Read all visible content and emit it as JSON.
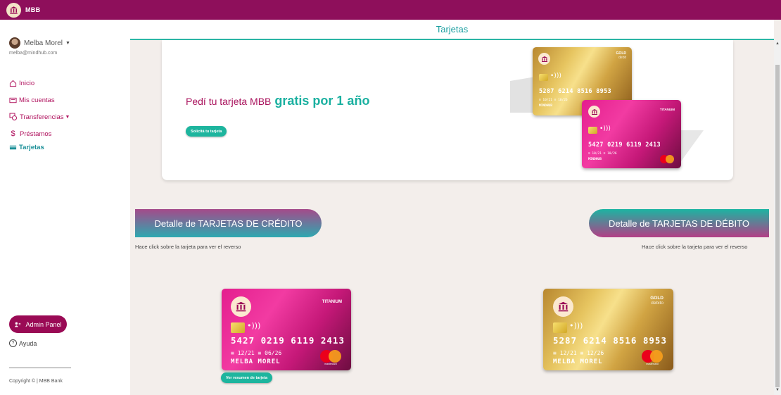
{
  "app": {
    "brand": "MBB",
    "page_title": "Tarjetas"
  },
  "user": {
    "name": "Melba Morel",
    "email": "melba@mindhub.com"
  },
  "nav": {
    "items": [
      {
        "label": "Inicio",
        "icon": "home-icon"
      },
      {
        "label": "Mis cuentas",
        "icon": "wallet-icon"
      },
      {
        "label": "Transferencias",
        "icon": "transfer-icon"
      },
      {
        "label": "Préstamos",
        "icon": "dollar-icon"
      },
      {
        "label": "Tarjetas",
        "icon": "card-icon",
        "active": true
      }
    ]
  },
  "sidebar": {
    "admin_label": "Admin Panel",
    "help_label": "Ayuda",
    "copyright": "Copyright © | MBB Bank"
  },
  "promo": {
    "text_a": "Pedí tu tarjeta MBB",
    "text_b": "gratis por 1 año",
    "button": "Solicitá tu tarjeta",
    "gold_card": {
      "tier": "GOLD",
      "type": "debit",
      "number": "5287 6214 8516 8953",
      "dates": "≡ 10/21 ≡ 10/26",
      "holder": "MINDHUB"
    },
    "pink_card": {
      "tier": "TITANIUM",
      "number": "5427 0219 6119 2413",
      "dates": "≡ 10/21 ≡ 10/26",
      "holder": "MINDHUB"
    }
  },
  "sections": {
    "credit_title": "Detalle de TARJETAS DE CRÉDITO",
    "debit_title": "Detalle de TARJETAS DE DÉBITO",
    "credit_hint": "Hace click sobre la tarjeta para ver el reverso",
    "debit_hint": "Hace click sobre la tarjeta para ver el reverso"
  },
  "credit_card": {
    "tier": "TITANIUM",
    "number": "5427 0219 6119 2413",
    "dates": "≡ 12/21 ≡ 06/26",
    "holder": "MELBA MOREL",
    "brand": "mastercard",
    "button": "Ver resumen de tarjeta"
  },
  "debit_card": {
    "tier": "GOLD",
    "type": "debito",
    "number": "5287 6214 8516 8953",
    "dates": "≡ 12/21 ≡ 12/26",
    "holder": "MELBA MOREL",
    "brand": "mastercard"
  },
  "colors": {
    "primary": "#8e0f5b",
    "accent": "#1ab0a0",
    "background": "#f3eeeb"
  }
}
